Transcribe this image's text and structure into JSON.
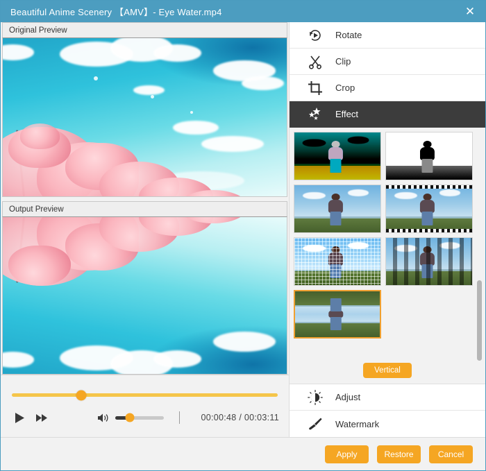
{
  "window": {
    "title": "Beautiful Anime Scenery 【AMV】- Eye Water.mp4",
    "close_label": "✕",
    "accent_color": "#f5a623",
    "titlebar_color": "#4c9dc0",
    "active_menu_color": "#3c3c3c"
  },
  "previews": {
    "original": {
      "header": "Original Preview"
    },
    "output": {
      "header": "Output Preview"
    }
  },
  "player": {
    "play_label": "play-icon",
    "forward_label": "fast-forward-icon",
    "volume_label": "volume-icon",
    "seek_percent": 26,
    "volume_percent": 30,
    "current_time": "00:00:48",
    "separator": "/",
    "total_time": "00:03:11",
    "time_display": "00:00:48  /  00:03:11"
  },
  "sidebar": {
    "top_items": [
      {
        "label": "Rotate",
        "icon": "rotate-icon",
        "active": false
      },
      {
        "label": "Clip",
        "icon": "scissors-icon",
        "active": false
      },
      {
        "label": "Crop",
        "icon": "crop-icon",
        "active": false
      },
      {
        "label": "Effect",
        "icon": "sparkle-icon",
        "active": true
      }
    ],
    "bottom_items": [
      {
        "label": "Adjust",
        "icon": "brightness-icon",
        "active": false
      },
      {
        "label": "Watermark",
        "icon": "brush-icon",
        "active": false
      }
    ]
  },
  "effects": {
    "vertical_button": "Vertical",
    "scroll_thumb_top_percent": 60,
    "scroll_thumb_height_percent": 33,
    "items": [
      {
        "name": "Neon Edge",
        "style": "neon",
        "selected": false
      },
      {
        "name": "Sketch",
        "style": "sketch",
        "selected": false
      },
      {
        "name": "Original",
        "style": "original",
        "selected": false
      },
      {
        "name": "Film Strip",
        "style": "film",
        "selected": false
      },
      {
        "name": "Mosaic",
        "style": "mosaic",
        "selected": false
      },
      {
        "name": "Blinds",
        "style": "blinds",
        "selected": false
      },
      {
        "name": "Vertical Mirror",
        "style": "mirror",
        "selected": true
      }
    ]
  },
  "footer": {
    "apply_label": "Apply",
    "restore_label": "Restore",
    "cancel_label": "Cancel"
  }
}
